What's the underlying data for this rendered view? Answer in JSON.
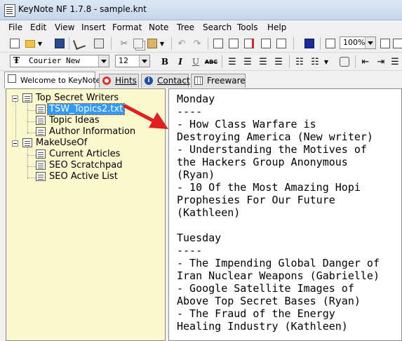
{
  "window": {
    "title": "KeyNote NF  1.7.8 - sample.knt"
  },
  "menu": [
    "File",
    "Edit",
    "View",
    "Insert",
    "Format",
    "Note",
    "Tree",
    "Search",
    "Tools",
    "Help"
  ],
  "toolbar": {
    "zoom": "100%",
    "font_name": "Courier New",
    "font_size": "12"
  },
  "tabs": [
    {
      "label": "Welcome to KeyNote",
      "icon": "note-icon",
      "active": true
    },
    {
      "label": "Hints",
      "icon": "lifebuoy-icon"
    },
    {
      "label": "Contact",
      "icon": "info-icon"
    },
    {
      "label": "Freeware",
      "icon": "grid-icon"
    }
  ],
  "tree": {
    "nodes": [
      {
        "label": "Top Secret Writers",
        "level": 0
      },
      {
        "label": "TSW_Topics2.txt",
        "level": 1,
        "selected": true
      },
      {
        "label": "Topic Ideas",
        "level": 1
      },
      {
        "label": "Author Information",
        "level": 1
      },
      {
        "label": "MakeUseOf",
        "level": 0
      },
      {
        "label": "Current Articles",
        "level": 1
      },
      {
        "label": "SEO Scratchpad",
        "level": 1
      },
      {
        "label": "SEO Active List",
        "level": 1
      }
    ]
  },
  "editor": {
    "lines": [
      "Monday",
      "----",
      "- How Class Warfare is",
      "Destroying America (New writer)",
      "- Understanding the Motives of",
      "the Hackers Group Anonymous",
      "(Ryan)",
      "- 10 Of the Most Amazing Hopi",
      "Prophesies For Our Future",
      "(Kathleen)",
      "",
      "Tuesday",
      "----",
      "- The Impending Global Danger of",
      "Iran Nuclear Weapons (Gabrielle)",
      "- Google Satellite Images of",
      "Above Top Secret Bases (Ryan)",
      "- The Fraud of the Energy",
      "Healing Industry (Kathleen)"
    ]
  },
  "colors": {
    "tree_background": "#fbf8ce",
    "selection": "#3399ff",
    "arrow": "#e02020"
  }
}
